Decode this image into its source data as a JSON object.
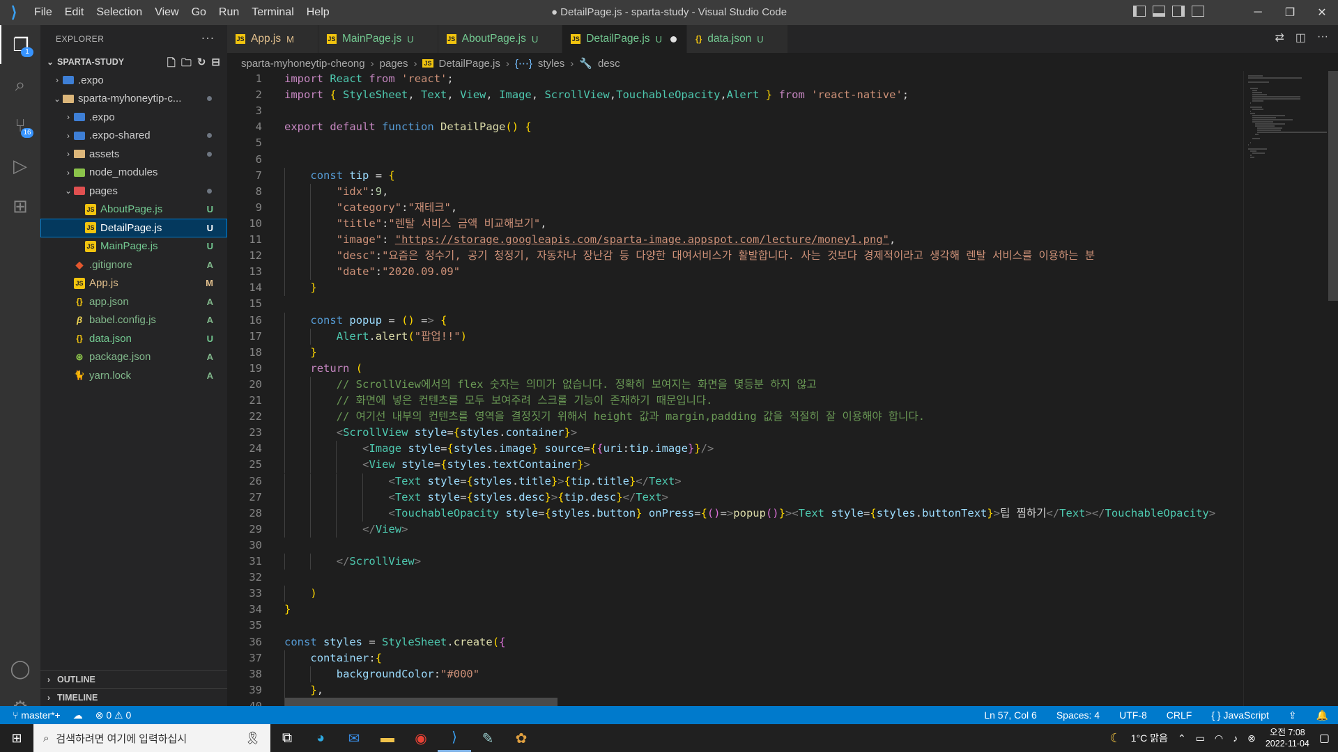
{
  "menu": [
    "File",
    "Edit",
    "Selection",
    "View",
    "Go",
    "Run",
    "Terminal",
    "Help"
  ],
  "window_title": "● DetailPage.js - sparta-study - Visual Studio Code",
  "activity": {
    "explorer_badge": "1",
    "scm_badge": "16",
    "settings_badge": "1"
  },
  "explorer": {
    "header": "EXPLORER",
    "project": "SPARTA-STUDY",
    "rows": [
      {
        "label": ".expo",
        "status": ""
      },
      {
        "label": "sparta-myhoneytip-c...",
        "status": ""
      },
      {
        "label": ".expo",
        "status": ""
      },
      {
        "label": ".expo-shared",
        "status": ""
      },
      {
        "label": "assets",
        "status": ""
      },
      {
        "label": "node_modules",
        "status": ""
      },
      {
        "label": "pages",
        "status": ""
      },
      {
        "label": "AboutPage.js",
        "status": "U"
      },
      {
        "label": "DetailPage.js",
        "status": "U"
      },
      {
        "label": "MainPage.js",
        "status": "U"
      },
      {
        "label": ".gitignore",
        "status": "A"
      },
      {
        "label": "App.js",
        "status": "M"
      },
      {
        "label": "app.json",
        "status": "A"
      },
      {
        "label": "babel.config.js",
        "status": "A"
      },
      {
        "label": "data.json",
        "status": "U"
      },
      {
        "label": "package.json",
        "status": "A"
      },
      {
        "label": "yarn.lock",
        "status": "A"
      }
    ],
    "outline": "OUTLINE",
    "timeline": "TIMELINE"
  },
  "tabs": [
    {
      "label": "App.js",
      "status": "M"
    },
    {
      "label": "MainPage.js",
      "status": "U"
    },
    {
      "label": "AboutPage.js",
      "status": "U"
    },
    {
      "label": "DetailPage.js",
      "status": "U"
    },
    {
      "label": "data.json",
      "status": "U"
    }
  ],
  "breadcrumb": [
    "sparta-myhoneytip-cheong",
    "pages",
    "DetailPage.js",
    "styles",
    "desc"
  ],
  "code_lines": [
    "import React from 'react';",
    "import { StyleSheet, Text, View, Image, ScrollView,TouchableOpacity,Alert } from 'react-native';",
    "",
    "export default function DetailPage() {",
    "",
    "",
    "    const tip = {",
    "        \"idx\":9,",
    "        \"category\":\"재테크\",",
    "        \"title\":\"렌탈 서비스 금액 비교해보기\",",
    "        \"image\": \"https://storage.googleapis.com/sparta-image.appspot.com/lecture/money1.png\",",
    "        \"desc\":\"요즘은 정수기, 공기 청정기, 자동차나 장난감 등 다양한 대여서비스가 활발합니다. 사는 것보다 경제적이라고 생각해 렌탈 서비스를 이용하는 분",
    "        \"date\":\"2020.09.09\"",
    "    }",
    "",
    "    const popup = () => {",
    "        Alert.alert(\"팝업!!\")",
    "    }",
    "    return (",
    "        // ScrollView에서의 flex 숫자는 의미가 없습니다. 정확히 보여지는 화면을 몇등분 하지 않고",
    "        // 화면에 넣은 컨텐츠를 모두 보여주려 스크롤 기능이 존재하기 때문입니다.",
    "        // 여기선 내부의 컨텐츠를 영역을 결정짓기 위해서 height 값과 margin,padding 값을 적절히 잘 이용해야 합니다.",
    "        <ScrollView style={styles.container}>",
    "            <Image style={styles.image} source={{uri:tip.image}}/>",
    "            <View style={styles.textContainer}>",
    "                <Text style={styles.title}>{tip.title}</Text>",
    "                <Text style={styles.desc}>{tip.desc}</Text>",
    "                <TouchableOpacity style={styles.button} onPress={()=>popup()}><Text style={styles.buttonText}>팁 찜하기</Text></TouchableOpacity>",
    "            </View>",
    "",
    "        </ScrollView>",
    "",
    "    )",
    "}",
    "",
    "const styles = StyleSheet.create({",
    "    container:{",
    "        backgroundColor:\"#000\"",
    "    },",
    "    image:{"
  ],
  "status": {
    "branch": "master*+",
    "errors": "0",
    "warnings": "0",
    "position": "Ln 57, Col 6",
    "spaces": "Spaces: 4",
    "encoding": "UTF-8",
    "eol": "CRLF",
    "language": "JavaScript"
  },
  "taskbar": {
    "search_placeholder": "검색하려면 여기에 입력하십시",
    "weather": "1°C 맑음",
    "time": "오전 7:08",
    "date": "2022-11-04"
  },
  "colors": {
    "statusbar": "#007acc",
    "accent": "#3794ff"
  }
}
